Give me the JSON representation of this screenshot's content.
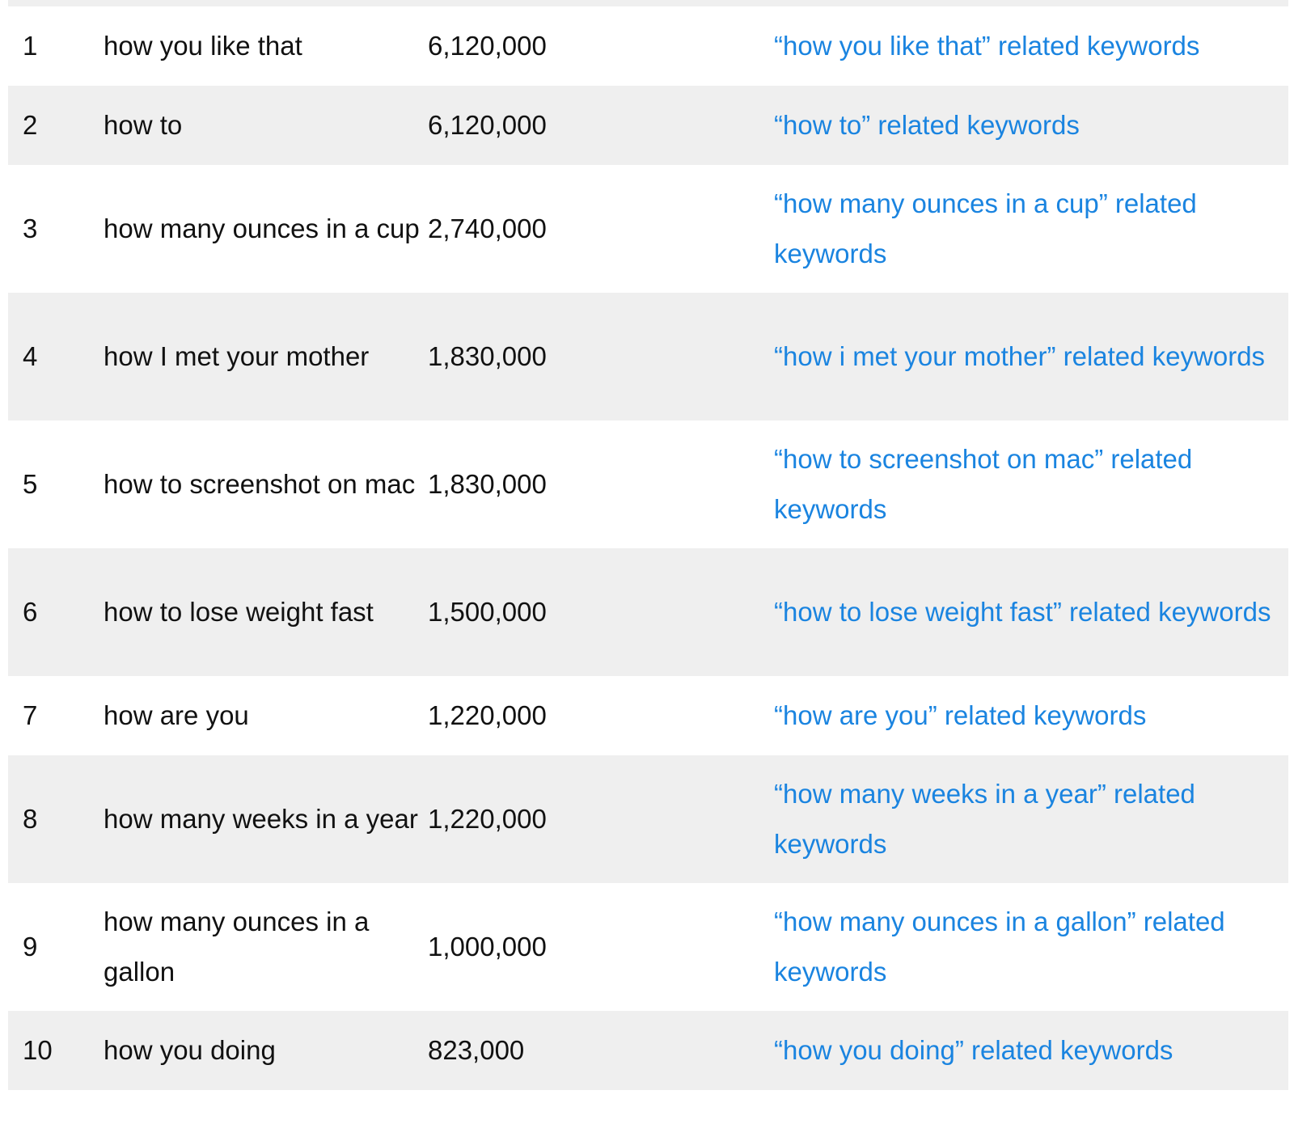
{
  "table": {
    "rows": [
      {
        "rank": "1",
        "keyword": "how you like that",
        "volume": "6,120,000",
        "link": "“how you like that” related keywords"
      },
      {
        "rank": "2",
        "keyword": "how to",
        "volume": "6,120,000",
        "link": "“how to” related keywords"
      },
      {
        "rank": "3",
        "keyword": "how many ounces in a cup",
        "volume": "2,740,000",
        "link": "“how many ounces in a cup” related keywords"
      },
      {
        "rank": "4",
        "keyword": "how I met your mother",
        "volume": "1,830,000",
        "link": "“how i met your mother” related keywords"
      },
      {
        "rank": "5",
        "keyword": "how to screenshot on mac",
        "volume": "1,830,000",
        "link": "“how to screenshot on mac” related keywords"
      },
      {
        "rank": "6",
        "keyword": "how to lose weight fast",
        "volume": "1,500,000",
        "link": "“how to lose weight fast” related keywords"
      },
      {
        "rank": "7",
        "keyword": "how are you",
        "volume": "1,220,000",
        "link": "“how are you” related keywords"
      },
      {
        "rank": "8",
        "keyword": "how many weeks in a year",
        "volume": "1,220,000",
        "link": "“how many weeks in a year” related keywords"
      },
      {
        "rank": "9",
        "keyword": "how many ounces in a gallon",
        "volume": "1,000,000",
        "link": "“how many ounces in a gallon” related keywords"
      },
      {
        "rank": "10",
        "keyword": "how you doing",
        "volume": "823,000",
        "link": "“how you doing” related keywords"
      }
    ]
  },
  "colors": {
    "link": "#1a84e0",
    "stripe": "#efefef",
    "text": "#111111"
  }
}
